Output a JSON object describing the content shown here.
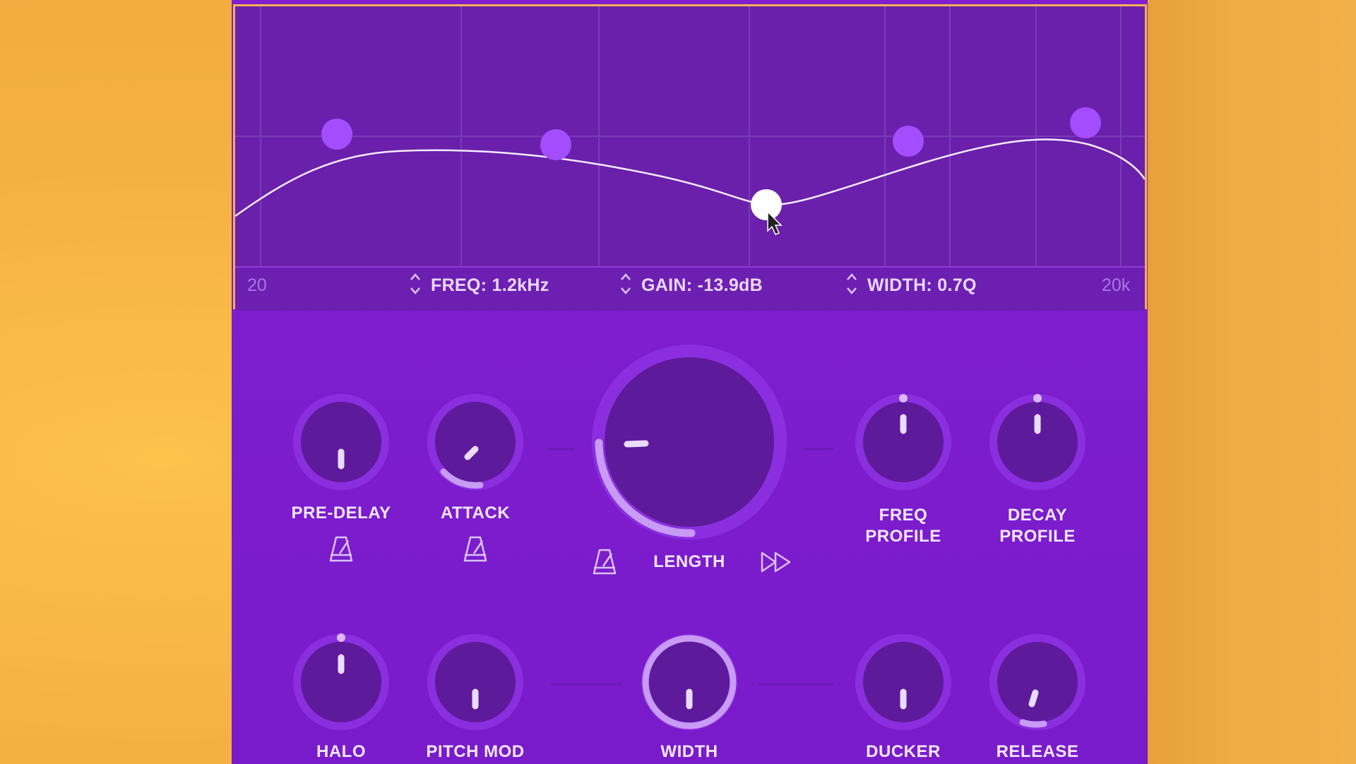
{
  "eq": {
    "range_min": "20",
    "range_max": "20k",
    "freq": "FREQ: 1.2kHz",
    "gain": "GAIN: -13.9dB",
    "width": "WIDTH: 0.7Q"
  },
  "knobs": {
    "pre_delay": "PRE-DELAY",
    "attack": "ATTACK",
    "length": "LENGTH",
    "freq_profile_1": "FREQ",
    "freq_profile_2": "PROFILE",
    "decay_profile_1": "DECAY",
    "decay_profile_2": "PROFILE",
    "halo": "HALO",
    "pitch_mod": "PITCH MOD",
    "width": "WIDTH",
    "ducker": "DUCKER",
    "release": "RELEASE"
  },
  "icons": {
    "tempo_sync": "metronome-icon",
    "fast_forward": "fast-forward-icon",
    "cursor": "mouse-cursor-icon"
  },
  "colors": {
    "background": "#f5b043",
    "plugin": "#7f1fd0",
    "eq_panel": "#6a20ab",
    "eq_border": "#f6b14e",
    "band_node": "#a44dff",
    "selected_node": "#ffffff"
  }
}
